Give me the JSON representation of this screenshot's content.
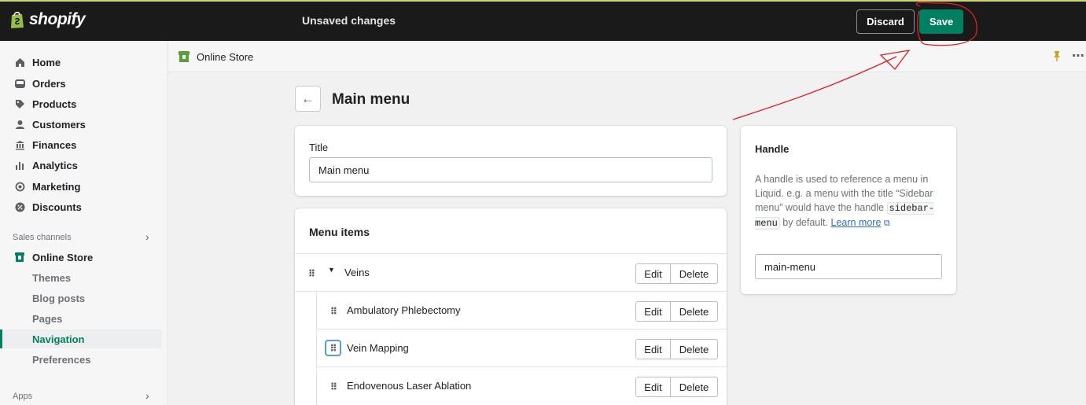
{
  "topbar": {
    "brand": "shopify",
    "status_text": "Unsaved changes",
    "discard_label": "Discard",
    "save_label": "Save"
  },
  "sidebar": {
    "items": [
      {
        "label": "Home",
        "icon": "home-icon"
      },
      {
        "label": "Orders",
        "icon": "inbox-icon"
      },
      {
        "label": "Products",
        "icon": "tag-icon"
      },
      {
        "label": "Customers",
        "icon": "person-icon"
      },
      {
        "label": "Finances",
        "icon": "bank-icon"
      },
      {
        "label": "Analytics",
        "icon": "bar-chart-icon"
      },
      {
        "label": "Marketing",
        "icon": "target-icon"
      },
      {
        "label": "Discounts",
        "icon": "discount-icon"
      }
    ],
    "sales_channels_label": "Sales channels",
    "online_store_label": "Online Store",
    "sub_items": [
      "Themes",
      "Blog posts",
      "Pages",
      "Navigation",
      "Preferences"
    ],
    "active_sub_item": "Navigation",
    "apps_label": "Apps"
  },
  "channel_bar": {
    "title": "Online Store"
  },
  "page": {
    "title": "Main menu"
  },
  "title_card": {
    "label": "Title",
    "value": "Main menu"
  },
  "menu_items_card": {
    "heading": "Menu items",
    "edit_label": "Edit",
    "delete_label": "Delete",
    "items": [
      {
        "label": "Veins",
        "level": 0,
        "expanded": true
      },
      {
        "label": "Ambulatory Phlebectomy",
        "level": 1
      },
      {
        "label": "Vein Mapping",
        "level": 1,
        "focused": true
      },
      {
        "label": "Endovenous Laser Ablation",
        "level": 1
      }
    ]
  },
  "handle_card": {
    "heading": "Handle",
    "help_prefix": "A handle is used to reference a menu in Liquid. e.g. a menu with the title “Sidebar menu” would have the handle",
    "help_code": "sidebar-menu",
    "help_suffix": "by default.",
    "learn_more": "Learn more",
    "value": "main-menu"
  },
  "colors": {
    "topbar": "#1a1a1a",
    "primary": "#008060",
    "annotation": "#e02020"
  }
}
